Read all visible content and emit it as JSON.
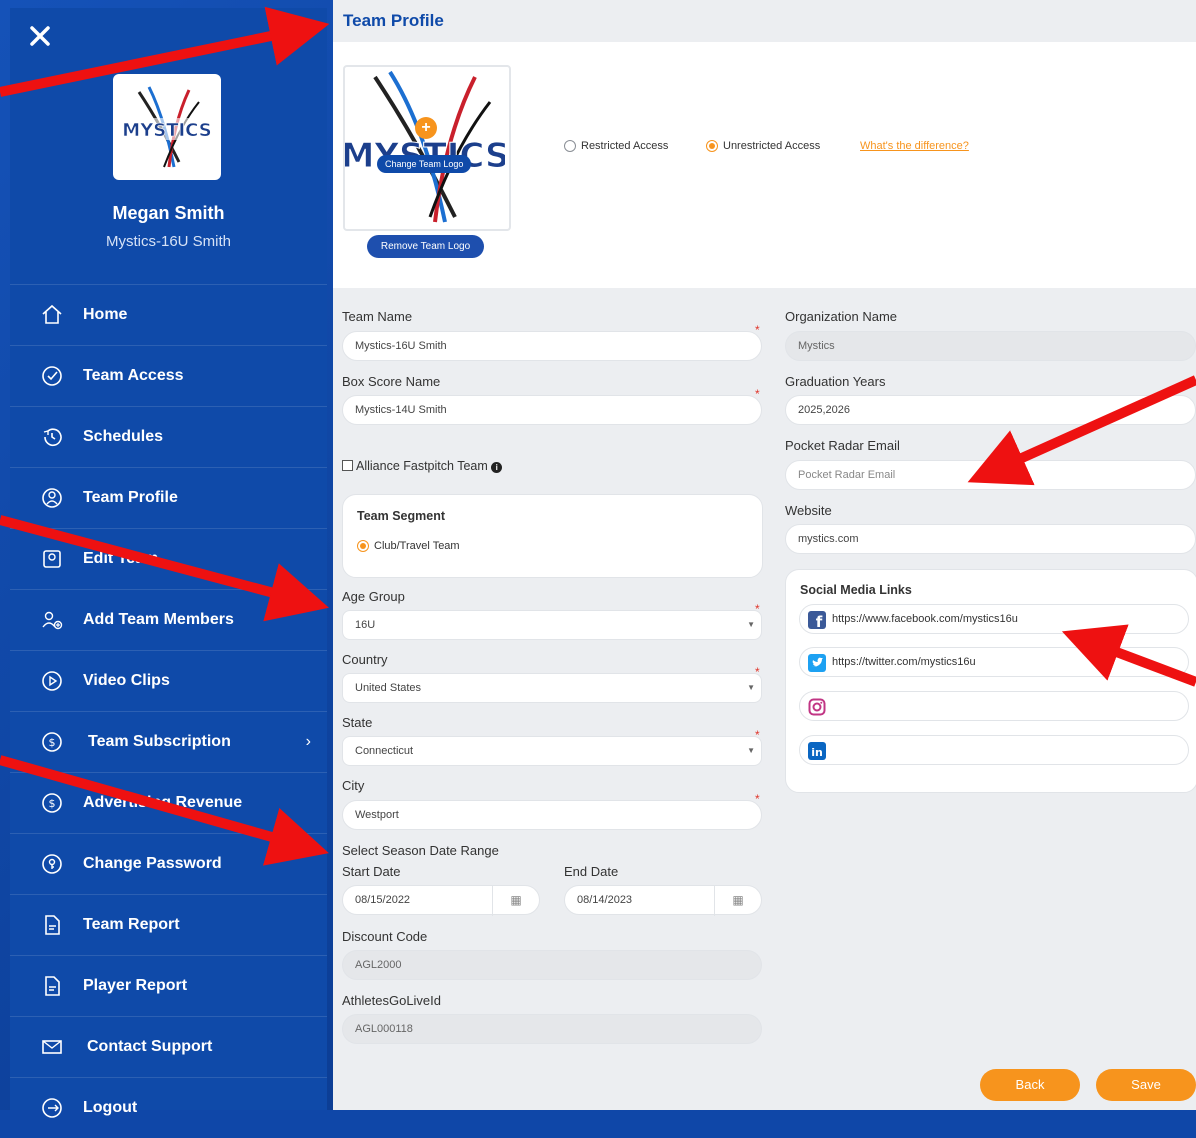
{
  "colors": {
    "sidebar": "#0f4aa9",
    "accent": "#f7941d",
    "title": "#0f4aa9",
    "annotation": "#ee1111"
  },
  "sidebar": {
    "close_icon": "close-icon",
    "user_name": "Megan Smith",
    "user_team": "Mystics-16U Smith",
    "items": [
      {
        "label": "Home",
        "icon": "home-icon"
      },
      {
        "label": "Team Access",
        "icon": "check-circle-icon"
      },
      {
        "label": "Schedules",
        "icon": "clock-history-icon"
      },
      {
        "label": "Team Profile",
        "icon": "team-profile-icon"
      },
      {
        "label": "Edit Team",
        "icon": "edit-team-icon"
      },
      {
        "label": "Add Team Members",
        "icon": "add-members-icon"
      },
      {
        "label": "Video Clips",
        "icon": "play-circle-icon"
      },
      {
        "label": "Team Subscription",
        "icon": "dollar-circle-icon",
        "chevron": "›"
      },
      {
        "label": "Advertising Revenue",
        "icon": "dollar-circle-icon"
      },
      {
        "label": "Change Password",
        "icon": "password-key-icon"
      },
      {
        "label": "Team Report",
        "icon": "document-icon"
      },
      {
        "label": "Player Report",
        "icon": "document-icon"
      },
      {
        "label": "Contact Support",
        "icon": "mail-icon"
      },
      {
        "label": "Logout",
        "icon": "logout-icon"
      }
    ]
  },
  "main": {
    "title": "Team Profile",
    "change_logo": "Change Team Logo",
    "remove_logo": "Remove Team Logo",
    "access": {
      "restricted": "Restricted Access",
      "unrestricted": "Unrestricted Access",
      "selected": "unrestricted",
      "diff_link": "What's the difference?"
    },
    "form": {
      "team_name_label": "Team Name",
      "team_name": "Mystics-16U Smith",
      "box_score_label": "Box Score Name",
      "box_score": "Mystics-14U Smith",
      "alliance_label": "Alliance Fastpitch Team",
      "segment_title": "Team Segment",
      "segment_option": "Club/Travel Team",
      "age_group_label": "Age Group",
      "age_group": "16U",
      "country_label": "Country",
      "country": "United States",
      "state_label": "State",
      "state": "Connecticut",
      "city_label": "City",
      "city": "Westport",
      "season_label": "Select Season Date Range",
      "start_label": "Start Date",
      "start_date": "08/15/2022",
      "end_label": "End Date",
      "end_date": "08/14/2023",
      "discount_label": "Discount Code",
      "discount": "AGL2000",
      "agl_label": "AthletesGoLiveId",
      "agl_id": "AGL000118",
      "org_label": "Organization Name",
      "org": "Mystics",
      "grad_label": "Graduation Years",
      "grad": "2025,2026",
      "radar_label": "Pocket Radar Email",
      "radar_placeholder": "Pocket Radar Email",
      "website_label": "Website",
      "website": "mystics.com",
      "social_title": "Social Media Links",
      "facebook": "https://www.facebook.com/mystics16u",
      "twitter": "https://twitter.com/mystics16u",
      "instagram": "",
      "linkedin": ""
    },
    "buttons": {
      "back": "Back",
      "save": "Save"
    }
  }
}
